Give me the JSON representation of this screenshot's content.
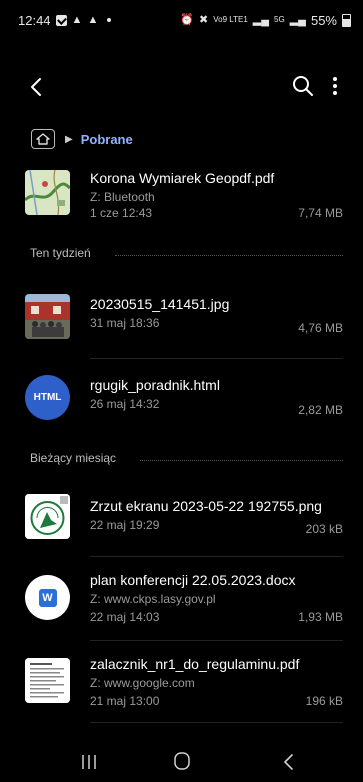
{
  "status_bar": {
    "time": "12:44",
    "battery_text": "55%",
    "net_label": "Vo9 LTE1",
    "net_label2": "5G"
  },
  "breadcrumb": {
    "current_folder": "Pobrane"
  },
  "files": [
    {
      "name": "Korona Wymiarek Geopdf.pdf",
      "source": "Z: Bluetooth",
      "date": "1 cze 12:43",
      "size": "7,74 MB"
    },
    {
      "name": "20230515_141451.jpg",
      "date": "31 maj 18:36",
      "size": "4,76 MB"
    },
    {
      "name": "rgugik_poradnik.html",
      "date": "26 maj 14:32",
      "size": "2,82 MB",
      "badge": "HTML"
    },
    {
      "name": "Zrzut ekranu 2023-05-22 192755.png",
      "date": "22 maj 19:29",
      "size": "203 kB"
    },
    {
      "name": "plan konferencji 22.05.2023.docx",
      "source": "Z: www.ckps.lasy.gov.pl",
      "date": "22 maj 14:03",
      "size": "1,93 MB",
      "badge": "W"
    },
    {
      "name": "zalacznik_nr1_do_regulaminu.pdf",
      "source": "Z: www.google.com",
      "date": "21 maj 13:00",
      "size": "196 kB"
    }
  ],
  "sections": {
    "this_week": "Ten tydzień",
    "this_month": "Bieżący miesiąc"
  },
  "colors": {
    "background": "#000000",
    "accent": "#8fb3ff",
    "secondary_text": "#9a9a9a",
    "html_badge": "#2f5fc8",
    "word_blue": "#2b6fd8"
  }
}
